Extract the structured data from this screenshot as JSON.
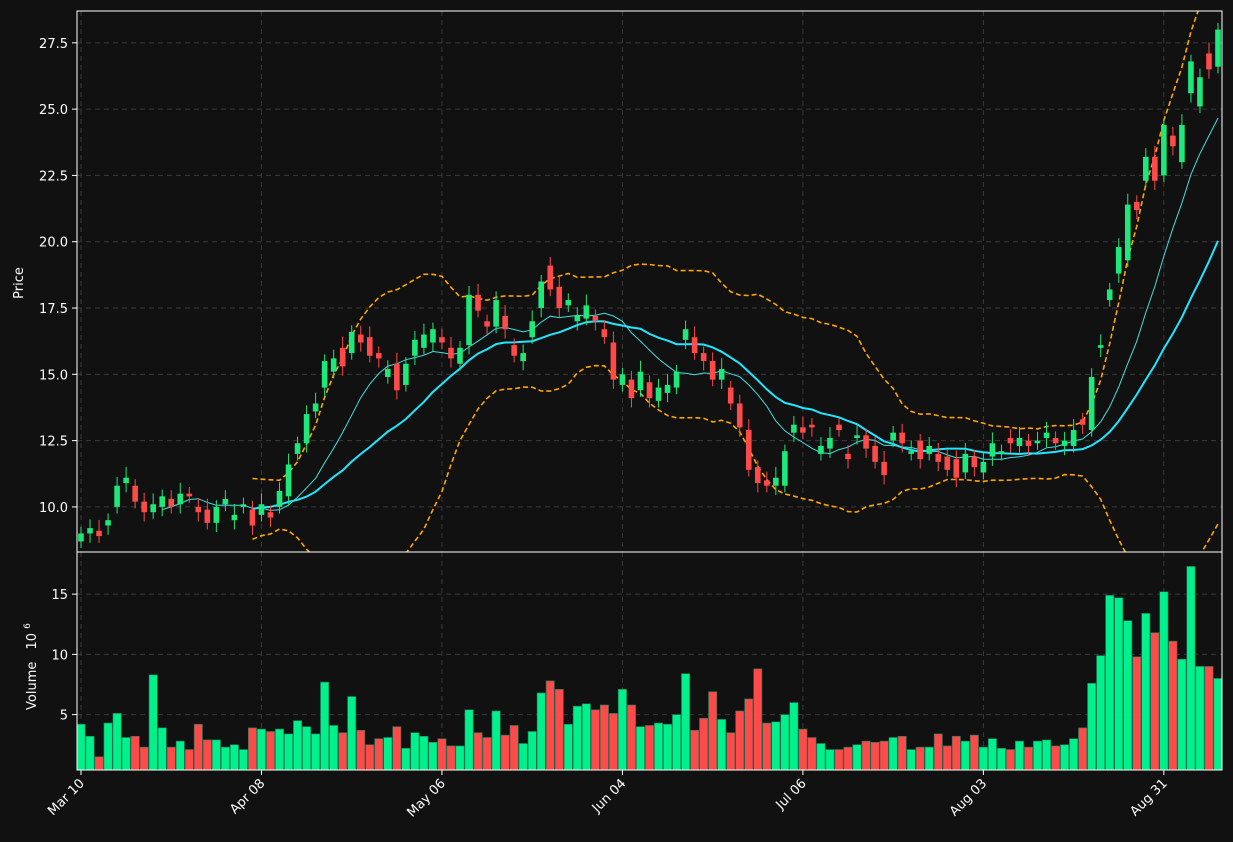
{
  "chart_data": {
    "type": "candlestick",
    "colors": {
      "background": "#111111",
      "up": "#1ee87a",
      "down": "#ff4a4a",
      "volume_up": "#00f08c",
      "volume_down": "#ff4a4a",
      "ma_fast": "#40e0e0",
      "ma_slow": "#22e6ff",
      "bollinger": "#ffa500",
      "grid": "#3a3a3a",
      "frame": "#ffffff"
    },
    "price_panel": {
      "ylabel": "Price",
      "ylim": [
        8.3,
        28.7
      ],
      "yticks": [
        10.0,
        12.5,
        15.0,
        17.5,
        20.0,
        22.5,
        25.0,
        27.5
      ],
      "ytick_labels": [
        "10.0",
        "12.5",
        "15.0",
        "17.5",
        "20.0",
        "22.5",
        "25.0",
        "27.5"
      ]
    },
    "volume_panel": {
      "ylabel": "Volume",
      "ylabel_exponent": "10",
      "ylabel_exponent_power": "6",
      "ylim": [
        0.4,
        18.5
      ],
      "yticks": [
        5,
        10,
        15
      ],
      "ytick_labels": [
        "5",
        "10",
        "15"
      ],
      "values": [
        4.2,
        3.2,
        1.5,
        4.3,
        5.1,
        3.1,
        3.2,
        2.3,
        8.3,
        3.9,
        2.3,
        2.8,
        2.1,
        4.2,
        2.9,
        2.9,
        2.3,
        2.5,
        2.1,
        3.9,
        3.8,
        3.6,
        3.8,
        3.4,
        4.5,
        4.0,
        3.4,
        7.7,
        4.1,
        3.5,
        6.5,
        3.7,
        2.5,
        3.0,
        3.1,
        4.0,
        2.2,
        3.5,
        3.2,
        2.7,
        3.0,
        2.4,
        2.4,
        5.4,
        3.5,
        3.1,
        5.3,
        3.3,
        4.1,
        2.6,
        3.6,
        6.8,
        7.8,
        7.1,
        4.2,
        5.7,
        5.9,
        5.4,
        5.8,
        5.1,
        7.1,
        5.8,
        4.0,
        4.1,
        4.3,
        4.2,
        5.0,
        8.4,
        3.7,
        4.7,
        6.9,
        4.6,
        3.5,
        5.3,
        6.3,
        8.8,
        4.3,
        4.4,
        5.0,
        6.0,
        3.8,
        3.1,
        2.6,
        2.1,
        2.1,
        2.3,
        2.5,
        2.8,
        2.7,
        2.8,
        3.1,
        3.2,
        2.1,
        2.3,
        2.3,
        3.4,
        2.4,
        3.2,
        2.8,
        3.3,
        2.3,
        3.0,
        2.2,
        2.1,
        2.8,
        2.3,
        2.8,
        2.9,
        2.4,
        2.5,
        3.0,
        3.9,
        7.6,
        9.9,
        14.9,
        14.7,
        12.8,
        9.8,
        13.4,
        11.8,
        15.2,
        11.1,
        9.6,
        17.3,
        9.0,
        9.0,
        8.0
      ]
    },
    "x_axis": {
      "tick_labels": [
        "Mar 10",
        "Apr 08",
        "May 06",
        "Jun 04",
        "Jul 06",
        "Aug 03",
        "Aug 31"
      ],
      "tick_indices": [
        0,
        20,
        40,
        60,
        80,
        100,
        120
      ]
    },
    "candles": {
      "close": [
        9.0,
        9.2,
        8.9,
        9.5,
        10.8,
        11.1,
        10.2,
        9.8,
        10.1,
        10.4,
        10.0,
        10.5,
        10.4,
        9.8,
        9.4,
        10.0,
        10.3,
        9.7,
        10.1,
        9.3,
        10.1,
        9.6,
        10.6,
        11.6,
        12.4,
        13.5,
        13.9,
        15.5,
        15.6,
        15.3,
        16.6,
        16.2,
        15.7,
        15.6,
        15.2,
        14.4,
        15.4,
        16.3,
        16.5,
        16.7,
        16.2,
        15.6,
        16.0,
        18.0,
        17.4,
        16.8,
        17.8,
        16.7,
        15.7,
        15.8,
        17.0,
        18.5,
        18.2,
        17.5,
        17.8,
        17.2,
        17.6,
        17.0,
        16.4,
        14.8,
        15.0,
        14.1,
        15.1,
        14.1,
        14.5,
        14.6,
        15.1,
        16.7,
        15.8,
        15.5,
        14.8,
        15.2,
        13.9,
        13.0,
        11.4,
        10.9,
        10.8,
        11.1,
        12.1,
        13.1,
        12.8,
        13.0,
        12.3,
        12.6,
        12.9,
        11.8,
        12.7,
        12.2,
        11.7,
        11.2,
        12.8,
        12.4,
        12.1,
        11.8,
        12.3,
        11.7,
        11.4,
        11.1,
        12.0,
        11.5,
        11.7,
        12.4,
        12.1,
        12.4,
        12.6,
        12.3,
        12.5,
        12.8,
        12.4,
        12.5,
        12.9,
        13.1,
        14.9,
        16.1,
        18.2,
        19.8,
        21.4,
        21.2,
        23.2,
        22.3,
        24.4,
        23.6,
        24.4,
        26.8,
        26.2,
        26.5,
        28.0
      ],
      "open": [
        8.7,
        9.0,
        9.1,
        9.3,
        10.0,
        10.9,
        10.8,
        10.2,
        9.8,
        10.0,
        10.3,
        10.1,
        10.5,
        10.0,
        9.9,
        9.4,
        10.1,
        9.5,
        10.0,
        9.9,
        9.7,
        9.8,
        10.0,
        10.4,
        12.0,
        12.4,
        13.6,
        14.5,
        15.1,
        16.0,
        15.8,
        16.5,
        16.4,
        15.8,
        14.9,
        15.4,
        14.6,
        15.7,
        16.0,
        16.2,
        16.4,
        16.0,
        15.4,
        16.1,
        18.0,
        17.0,
        16.8,
        17.2,
        16.1,
        15.5,
        16.4,
        17.5,
        19.1,
        18.3,
        17.6,
        17.0,
        17.1,
        17.2,
        16.7,
        16.2,
        14.6,
        14.8,
        14.4,
        14.7,
        14.0,
        14.3,
        14.5,
        16.3,
        16.4,
        15.8,
        15.5,
        14.8,
        14.5,
        13.9,
        12.9,
        11.5,
        11.0,
        10.8,
        10.8,
        12.8,
        13.0,
        13.1,
        12.0,
        12.2,
        13.1,
        12.0,
        12.6,
        12.7,
        12.3,
        11.7,
        12.5,
        12.8,
        12.0,
        12.5,
        12.0,
        12.0,
        11.9,
        11.8,
        11.3,
        11.9,
        11.3,
        11.9,
        12.0,
        12.6,
        12.3,
        12.5,
        12.4,
        12.6,
        12.6,
        12.3,
        12.3,
        13.3,
        12.9,
        16.0,
        17.8,
        18.8,
        19.3,
        21.5,
        22.3,
        23.2,
        22.5,
        24.0,
        23.0,
        25.6,
        25.1,
        27.1,
        26.6
      ]
    }
  }
}
